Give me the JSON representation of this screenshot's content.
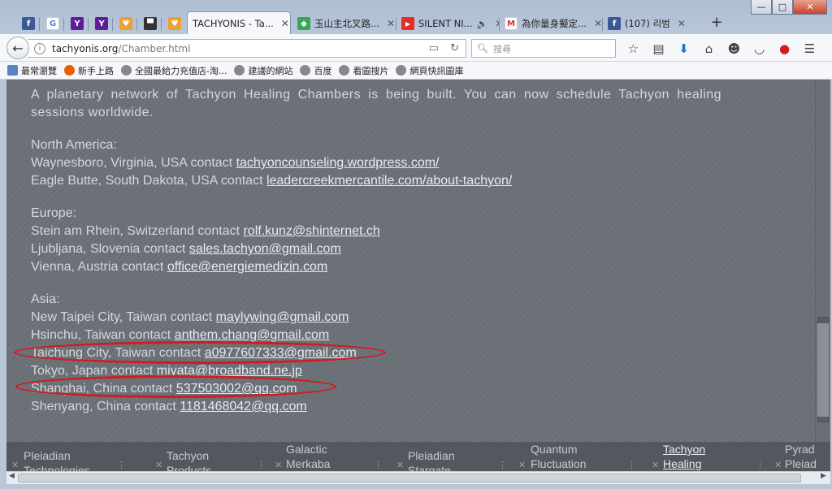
{
  "window": {
    "controls": [
      "—",
      "□",
      "✕"
    ]
  },
  "tabs": {
    "pinned": [
      {
        "icon": "facebook-icon",
        "glyph": "f",
        "color": "#3b5998"
      },
      {
        "icon": "google-icon",
        "glyph": "G",
        "color": "#ffffff"
      },
      {
        "icon": "yahoo-icon",
        "glyph": "Y",
        "color": "#5f1d9a"
      },
      {
        "icon": "yahoo-icon",
        "glyph": "Y",
        "color": "#5f1d9a"
      },
      {
        "icon": "app-icon",
        "glyph": "♥",
        "color": "#f0a030"
      },
      {
        "icon": "monitor-icon",
        "glyph": "▀",
        "color": "#333333"
      },
      {
        "icon": "app-icon",
        "glyph": "♥",
        "color": "#f0a030"
      }
    ],
    "open": [
      {
        "title": "TACHYONIS - Ta...",
        "icon": "",
        "active": true
      },
      {
        "title": "玉山主北叉路...",
        "icon": "maps-icon",
        "glyph": "◆",
        "color": "#34a853"
      },
      {
        "title": "SILENT NI...",
        "icon": "youtube-icon",
        "glyph": "▶",
        "color": "#e52d27",
        "audio": "🔊"
      },
      {
        "title": "為你量身擬定...",
        "icon": "gmail-icon",
        "glyph": "M",
        "color": "#d93025"
      },
      {
        "title": "(107) 리범",
        "icon": "facebook-icon",
        "glyph": "f",
        "color": "#3b5998"
      }
    ],
    "new_tab": "+"
  },
  "navbar": {
    "url_host": "tachyonis.org",
    "url_path": "/Chamber.html",
    "search_placeholder": "搜尋"
  },
  "bookmarks": [
    {
      "label": "最常瀏覽",
      "icon": "folder-icon"
    },
    {
      "label": "新手上路",
      "icon": "firefox-icon"
    },
    {
      "label": "全國最給力充值店-淘...",
      "icon": "globe-icon"
    },
    {
      "label": "建議的網站",
      "icon": "globe-icon"
    },
    {
      "label": "百度",
      "icon": "globe-icon"
    },
    {
      "label": "看圖搜片",
      "icon": "globe-icon"
    },
    {
      "label": "網頁快訊圖庫",
      "icon": "globe-icon"
    }
  ],
  "content": {
    "intro": "A planetary network of Tachyon Healing Chambers is being built. You can now schedule Tachyon healing sessions worldwide.",
    "regions": [
      {
        "name": "North America:",
        "entries": [
          {
            "location": "Waynesboro, Virginia, USA contact ",
            "link": "tachyoncounseling.wordpress.com/"
          },
          {
            "location": "Eagle Butte, South Dakota, USA contact ",
            "link": "leadercreekmercantile.com/about-tachyon/"
          }
        ]
      },
      {
        "name": "Europe:",
        "entries": [
          {
            "location": "Stein am Rhein, Switzerland contact ",
            "link": "rolf.kunz@shinternet.ch"
          },
          {
            "location": "Ljubljana, Slovenia contact ",
            "link": "sales.tachyon@gmail.com"
          },
          {
            "location": "Vienna, Austria contact ",
            "link": "office@energiemedizin.com"
          }
        ]
      },
      {
        "name": "Asia:",
        "entries": [
          {
            "location": "New Taipei City, Taiwan contact ",
            "link": "maylywing@gmail.com"
          },
          {
            "location": "Hsinchu, Taiwan contact ",
            "link": "anthem.chang@gmail.com"
          },
          {
            "location": "Taichung City, Taiwan contact ",
            "link": "a0977607333@gmail.com",
            "circled": true
          },
          {
            "location": "Tokyo, Japan contact ",
            "link": "miyata@broadband.ne.jp"
          },
          {
            "location": "Shanghai, China contact ",
            "link": "537503002@qq.com",
            "circled": true
          },
          {
            "location": "Shenyang, China contact ",
            "link": "1181468042@qq.com"
          }
        ]
      }
    ]
  },
  "footer_nav": [
    {
      "line1": "Pleiadian",
      "line2": "Technologies"
    },
    {
      "line1": "Tachyon",
      "line2": "Products"
    },
    {
      "line1": "Galactic",
      "line2": "Merkaba"
    },
    {
      "line1": "Pleiadian",
      "line2": "Stargate"
    },
    {
      "line1": "Quantum",
      "line2": "Fluctuation"
    },
    {
      "line1": "Tachyon",
      "line2": "Healing"
    },
    {
      "line1": "Pyrad",
      "line2": "Pleiad"
    }
  ],
  "colors": {
    "page_bg": "#6a6f75",
    "text": "#d4d8dc",
    "annotation_red": "#d01b1f"
  }
}
